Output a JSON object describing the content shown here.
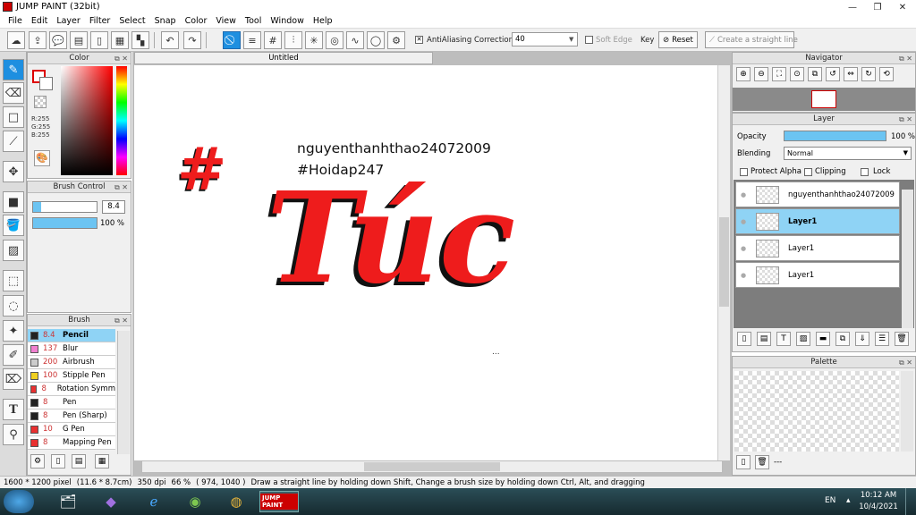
{
  "window": {
    "title": "JUMP PAINT (32bit)"
  },
  "menu": [
    "File",
    "Edit",
    "Layer",
    "Filter",
    "Select",
    "Snap",
    "Color",
    "View",
    "Tool",
    "Window",
    "Help"
  ],
  "toolbar": {
    "antialiasing_label": "AntiAliasing",
    "correction_label": "Correction",
    "correction_value": "40",
    "soft_edge_label": "Soft Edge",
    "key_label": "Key",
    "reset_label": "Reset",
    "straight_line_label": "Create a straight line"
  },
  "color_panel": {
    "title": "Color",
    "r": "R:255",
    "g": "G:255",
    "b": "B:255",
    "fg_color": "#ffffff",
    "accent": "#1e8fe0"
  },
  "brush_control": {
    "title": "Brush Control",
    "size": "8.4",
    "opacity": "100 %",
    "opacity_fraction": 1.0
  },
  "brush_panel": {
    "title": "Brush",
    "items": [
      {
        "size": "8.4",
        "name": "Pencil",
        "color": "#222222",
        "selected": true
      },
      {
        "size": "137",
        "name": "Blur",
        "color": "#f080d0",
        "selected": false
      },
      {
        "size": "200",
        "name": "Airbrush",
        "color": "#cccccc",
        "selected": false
      },
      {
        "size": "100",
        "name": "Stipple Pen",
        "color": "#f0d020",
        "selected": false
      },
      {
        "size": "8",
        "name": "Rotation Symm",
        "color": "#e83030",
        "selected": false
      },
      {
        "size": "8",
        "name": "Pen",
        "color": "#222222",
        "selected": false
      },
      {
        "size": "8",
        "name": "Pen (Sharp)",
        "color": "#222222",
        "selected": false
      },
      {
        "size": "10",
        "name": "G Pen",
        "color": "#e83030",
        "selected": false
      },
      {
        "size": "8",
        "name": "Mapping Pen",
        "color": "#e83030",
        "selected": false
      }
    ]
  },
  "document": {
    "tab_title": "Untitled",
    "text_line1": "nguyenthanhthao24072009",
    "text_line2": "#Hoidap247",
    "art_text": "Túc",
    "hash_mark": "#",
    "ellipsis": "...",
    "art_color": "#ee1c1c"
  },
  "navigator": {
    "title": "Navigator"
  },
  "layer_panel": {
    "title": "Layer",
    "opacity_label": "Opacity",
    "opacity_value": "100 %",
    "blending_label": "Blending",
    "blending_value": "Normal",
    "protect_alpha_label": "Protect Alpha",
    "clipping_label": "Clipping",
    "lock_label": "Lock",
    "layers": [
      {
        "name": "nguyenthanhthao24072009",
        "selected": false
      },
      {
        "name": "Layer1",
        "selected": true
      },
      {
        "name": "Layer1",
        "selected": false
      },
      {
        "name": "Layer1",
        "selected": false
      }
    ]
  },
  "palette": {
    "title": "Palette",
    "more": "---"
  },
  "status": {
    "size": "1600 * 1200 pixel",
    "physical": "(11.6 * 8.7cm)",
    "dpi": "350 dpi",
    "zoom": "66 %",
    "coords": "( 974, 1040 )",
    "hint": "Draw a straight line by holding down Shift, Change a brush size by holding down Ctrl, Alt, and dragging"
  },
  "taskbar": {
    "lang": "EN",
    "time": "10:12 AM",
    "date": "10/4/2021",
    "app_label": "JUMP PAINT"
  }
}
